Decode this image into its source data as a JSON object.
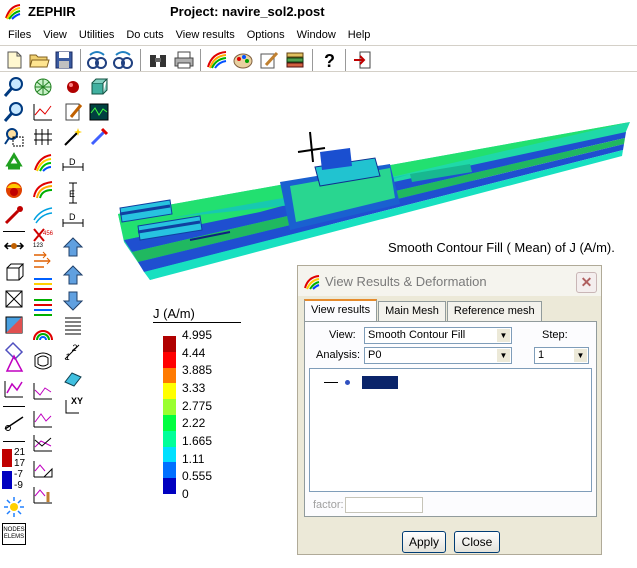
{
  "window": {
    "app_name": "ZEPHIR",
    "project_title": "Project: navire_sol2.post"
  },
  "menubar": {
    "items": [
      "Files",
      "View",
      "Utilities",
      "Do cuts",
      "View results",
      "Options",
      "Window",
      "Help"
    ]
  },
  "toolbar": {
    "icons": [
      "new-file-icon",
      "open-folder-icon",
      "save-icon",
      "undo-view-icon",
      "redo-view-icon",
      "binoculars-icon",
      "print-icon",
      "rainbow-icon",
      "paint-palette-icon",
      "edit-brush-icon",
      "layers-icon",
      "help-icon",
      "exit-icon"
    ]
  },
  "palette": {
    "numbers": [
      "21",
      "17",
      "-7",
      "-9"
    ],
    "nodes_elems_label": "NODES ELEMS",
    "xy_label": "XY",
    "e_label": "E",
    "d_label": "D",
    "n456_label": "456",
    "n123_label": "123"
  },
  "view": {
    "contour_caption": "Smooth Contour Fill ( Mean) of J (A/m)."
  },
  "legend": {
    "title": "J (A/m)",
    "values": [
      "4.995",
      "4.44",
      "3.885",
      "3.33",
      "2.775",
      "2.22",
      "1.665",
      "1.11",
      "0.555",
      "0"
    ],
    "colors": [
      "#b00000",
      "#ff0000",
      "#ff7a00",
      "#ffff00",
      "#9aff30",
      "#00ff40",
      "#00ff99",
      "#00e0ff",
      "#0070ff",
      "#0000c0"
    ]
  },
  "dialog": {
    "title": "View Results & Deformation",
    "tabs": [
      "View results",
      "Main Mesh",
      "Reference mesh"
    ],
    "view_label": "View:",
    "view_value": "Smooth Contour Fill",
    "step_label": "Step:",
    "analysis_label": "Analysis:",
    "analysis_value": "P0",
    "step_value": "1",
    "factor_label": "factor:",
    "apply_label": "Apply",
    "close_label": "Close"
  }
}
